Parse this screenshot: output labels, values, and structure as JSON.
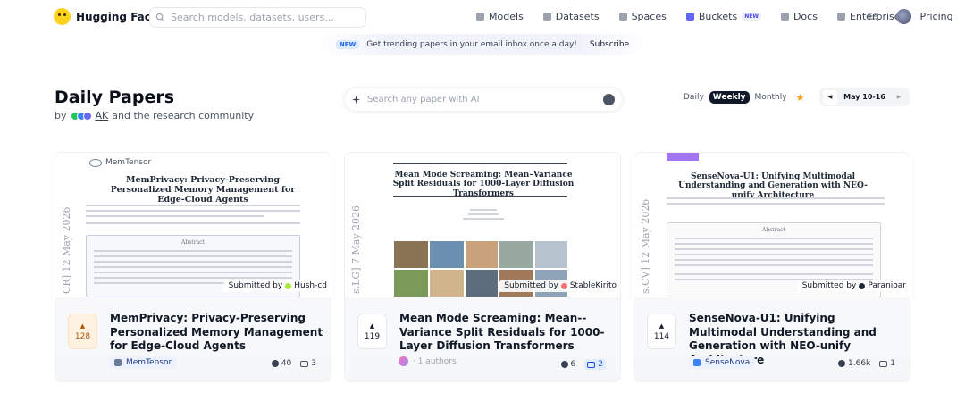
{
  "nav": {
    "brand": "Hugging Face",
    "search_placeholder": "Search models, datasets, users...",
    "links": [
      {
        "label": "Models",
        "icon": "models-icon"
      },
      {
        "label": "Datasets",
        "icon": "datasets-icon"
      },
      {
        "label": "Spaces",
        "icon": "spaces-icon"
      },
      {
        "label": "Buckets",
        "icon": "buckets-icon",
        "badge": "NEW"
      },
      {
        "label": "Docs",
        "icon": "docs-icon"
      },
      {
        "label": "Enterprise",
        "icon": "enterprise-icon"
      },
      {
        "label": "Pricing",
        "icon": ""
      }
    ]
  },
  "banner": {
    "badge": "NEW",
    "text": "Get trending papers in your email inbox once a day!",
    "subscribe": "Subscribe"
  },
  "header": {
    "title": "Daily Papers",
    "by": "by",
    "curator": "AK",
    "community": "and the research community",
    "search_placeholder": "Search any paper with AI",
    "period_daily": "Daily",
    "period_weekly": "Weekly",
    "period_monthly": "Monthly",
    "date_range": "May 10-16"
  },
  "papers": [
    {
      "title": "MemPrivacy: Privacy-Preserving Personalized Memory Management for Edge-Cloud Agents",
      "upvotes": "128",
      "org": "MemTensor",
      "github": "40",
      "comments": "3",
      "submitted_label": "Submitted by",
      "submitter": "Hush-cd",
      "thumb_header": "MemTensor",
      "thumb_title": "MemPrivacy: Privacy-Preserving Personalized Memory Management for Edge-Cloud Agents",
      "thumb_side": "CR] 12 May 2026",
      "thumb_abstract": "Abstract"
    },
    {
      "title": "Mean Mode Screaming: Mean--Variance Split Residuals for 1000-Layer Diffusion Transformers",
      "upvotes": "119",
      "authors": "· 1 authors",
      "github": "6",
      "comments": "2",
      "submitted_label": "Submitted by",
      "submitter": "StableKirito",
      "thumb_title": "Mean Mode Screaming: Mean–Variance Split Residuals for 1000-Layer Diffusion Transformers",
      "thumb_side": "s.LG] 7 May 2026"
    },
    {
      "title": "SenseNova-U1: Unifying Multimodal Understanding and Generation with NEO-unify Architecture",
      "upvotes": "114",
      "org": "SenseNova",
      "github": "1.66k",
      "comments": "1",
      "submitted_label": "Submitted by",
      "submitter": "Paranioar",
      "thumb_title": "SenseNova-U1: Unifying Multimodal Understanding and Generation with NEO-unify Architecture",
      "thumb_side": "s.CV] 12 May 2026",
      "thumb_abstract": "Abstract"
    }
  ],
  "colors": {
    "accent": "#ffd21e",
    "hot_upvote_bg": "#fff1e0",
    "hot_upvote_text": "#b45309",
    "weekly_bg": "#111827"
  }
}
